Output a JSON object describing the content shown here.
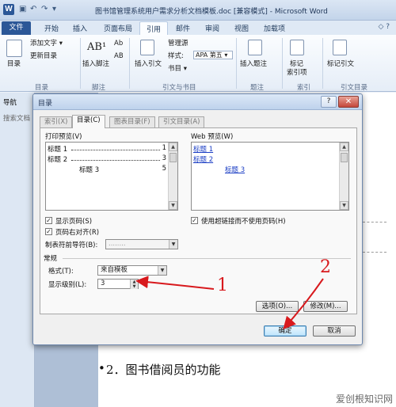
{
  "window": {
    "title": "图书馆管理系统用户需求分析文档模板.doc [兼容模式] - Microsoft Word",
    "app_icon": "W"
  },
  "ribbon_tabs": {
    "file": "文件",
    "items": [
      "开始",
      "插入",
      "页面布局",
      "引用",
      "邮件",
      "审阅",
      "视图",
      "加载项"
    ],
    "active": "引用"
  },
  "ribbon": {
    "toc": {
      "button": "目录",
      "group": "目录",
      "add_text": "添加文字 ▾",
      "update_toc": "更新目录"
    },
    "footnotes": {
      "insert_footnote": "插入脚注",
      "group": "脚注",
      "ab_icon": "AB¹",
      "ab_small": "Ab",
      "ab_small2": "AB"
    },
    "citations": {
      "insert_citation": "插入引文",
      "manage_sources": "管理源",
      "style_label": "样式:",
      "style_value": "APA 第五 ▾",
      "bibliography": "书目 ▾",
      "group": "引文与书目"
    },
    "captions": {
      "insert_caption": "插入题注",
      "group": "题注"
    },
    "index": {
      "mark_entry": "标记",
      "mark_entry2": "索引项",
      "group": "索引"
    },
    "authorities": {
      "mark_citation": "标记引文",
      "group": "引文目录"
    }
  },
  "nav_pane": {
    "title": "导航",
    "search": "搜索文档"
  },
  "document": {
    "heading": "2．图书借阅员的功能",
    "bullet": "•"
  },
  "watermark": "爱创根知识网",
  "dialog": {
    "title": "目录",
    "help": "?",
    "close": "✕",
    "tabs": [
      "索引(X)",
      "目录(C)",
      "图表目录(F)",
      "引文目录(A)"
    ],
    "active_tab": "目录(C)",
    "print_preview_label": "打印预览(V)",
    "print_preview": [
      {
        "text": "标题 1",
        "page": "1"
      },
      {
        "text": "标题 2",
        "page": "3"
      },
      {
        "text": "标题 3",
        "page": "5"
      }
    ],
    "web_preview_label": "Web 预览(W)",
    "web_preview": [
      "标题 1",
      "标题 2",
      "标题 3"
    ],
    "show_page_numbers": {
      "label": "显示页码(S)",
      "checked": true
    },
    "right_align": {
      "label": "页码右对齐(R)",
      "checked": true
    },
    "tab_leader_label": "制表符前导符(B):",
    "tab_leader_value": "........",
    "use_hyperlinks": {
      "label": "使用超链接而不使用页码(H)",
      "checked": true
    },
    "general_label": "常规",
    "format_label": "格式(T):",
    "format_value": "来自模板",
    "levels_label": "显示级别(L):",
    "levels_value": "3",
    "options_button": "选项(O)...",
    "modify_button": "修改(M)...",
    "ok_button": "确定",
    "cancel_button": "取消"
  },
  "annotations": {
    "one": "1",
    "two": "2"
  },
  "colors": {
    "accent": "#2b5797",
    "annotation": "#d8191d",
    "link": "#1a3dc4"
  }
}
